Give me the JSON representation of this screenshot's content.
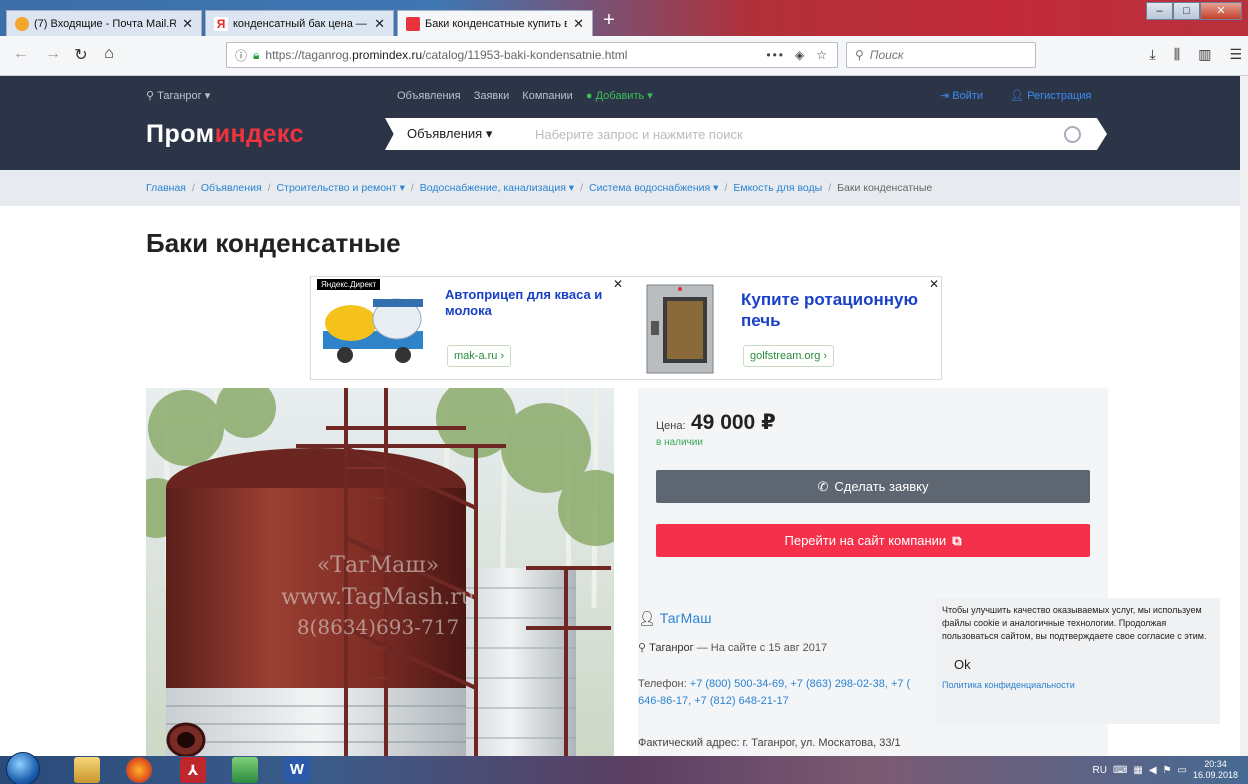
{
  "browser": {
    "tabs": [
      {
        "title": "(7) Входящие - Почта Mail.Ru",
        "active": false
      },
      {
        "title": "конденсатный бак цена — Ян",
        "active": false
      },
      {
        "title": "Баки конденсатные купить в Т",
        "active": true
      }
    ],
    "url_prefix": "https://taganrog.",
    "url_host": "promindex.ru",
    "url_path": "/catalog/11953-baki-kondensatnie.html",
    "search_placeholder": "Поиск",
    "more_label": "•••"
  },
  "site": {
    "city": "Таганрог",
    "nav": [
      "Объявления",
      "Заявки",
      "Компании"
    ],
    "add_label": "Добавить",
    "login": "Войти",
    "register": "Регистрация",
    "logo_part1": "Пром",
    "logo_part2": "индекс",
    "search_category": "Объявления",
    "search_placeholder": "Наберите запрос и нажмите поиск"
  },
  "breadcrumb": [
    "Главная",
    "Объявления",
    "Строительство и ремонт",
    "Водоснабжение, канализация",
    "Система водоснабжения",
    "Емкость для воды",
    "Баки конденсатные"
  ],
  "page_title": "Баки конденсатные",
  "ads": {
    "badge": "Яндекс.Директ",
    "items": [
      {
        "title": "Автоприцеп для кваса и молока",
        "site": "mak-a.ru ›"
      },
      {
        "title": "Купите ротационную печь",
        "site": "golfstream.org ›"
      }
    ]
  },
  "watermark": [
    "«ТагМаш»",
    "www.TagMash.ru",
    "8(8634)693-717"
  ],
  "product": {
    "price_label": "Цена:",
    "price": "49 000 ₽",
    "stock": "в наличии",
    "request_btn": "Сделать заявку",
    "site_btn": "Перейти на сайт компании",
    "company": "ТагМаш",
    "city": "Таганрог",
    "since": " — На сайте с 15 авг 2017",
    "phone_label": "Телефон:",
    "phones_line1": "+7 (800) 500-34-69, +7 (863) 298-02-38, +7 (",
    "phones_line2": "646-86-17, +7 (812) 648-21-17",
    "address": "Фактический адрес: г. Таганрог, ул. Москатова, 33/1"
  },
  "cookie": {
    "text": "Чтобы улучшить качество оказываемых услуг, мы используем файлы cookie и аналогичные технологии. Продолжая пользоваться сайтом, вы подтверждаете свое согласие с этим.",
    "ok": "Ok",
    "policy": "Политика конфиденциальности"
  },
  "taskbar": {
    "lang": "RU",
    "time": "20:34",
    "date": "16.09.2018"
  },
  "colors": {
    "header_bg": "#2c3548",
    "accent_red": "#f5304a",
    "link_blue": "#2a83d3",
    "gray_button": "#5e6672"
  }
}
